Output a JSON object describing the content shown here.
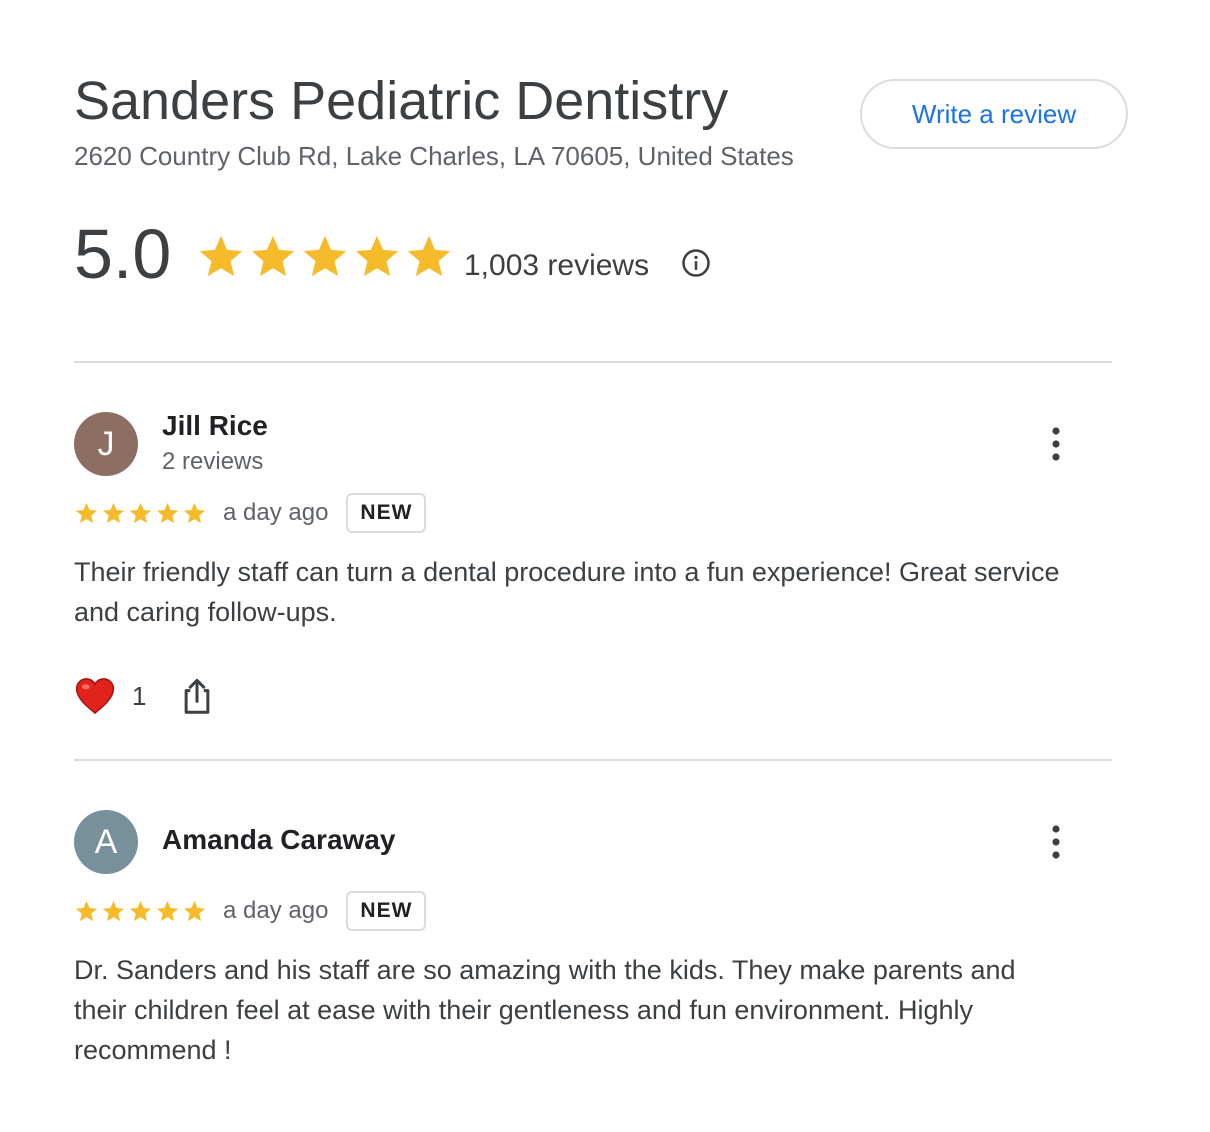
{
  "business": {
    "name": "Sanders Pediatric Dentistry",
    "address": "2620 Country Club Rd, Lake Charles, LA 70605, United States",
    "write_review_label": "Write a review",
    "rating": "5.0",
    "stars": 5,
    "review_count_label": "1,003 reviews"
  },
  "colors": {
    "star": "#f6bb2b",
    "accent": "#1a73e8",
    "heart": "#e0241b"
  },
  "icons": {
    "info": "info-icon",
    "more": "more-vert-icon",
    "like": "heart-icon",
    "share": "share-icon"
  },
  "reviews": [
    {
      "initial": "J",
      "avatar_color": "#8d6e63",
      "name": "Jill Rice",
      "meta": "2 reviews",
      "stars": 5,
      "date": "a day ago",
      "badge": "NEW",
      "text": "Their friendly staff can turn a dental procedure into a fun experience! Great service and caring follow-ups.",
      "likes": "1"
    },
    {
      "initial": "A",
      "avatar_color": "#78909c",
      "name": "Amanda Caraway",
      "stars": 5,
      "date": "a day ago",
      "badge": "NEW",
      "text": "Dr. Sanders and his staff are so amazing with the kids. They make parents and their children feel at ease with their gentleness and fun environment. Highly recommend !"
    }
  ]
}
